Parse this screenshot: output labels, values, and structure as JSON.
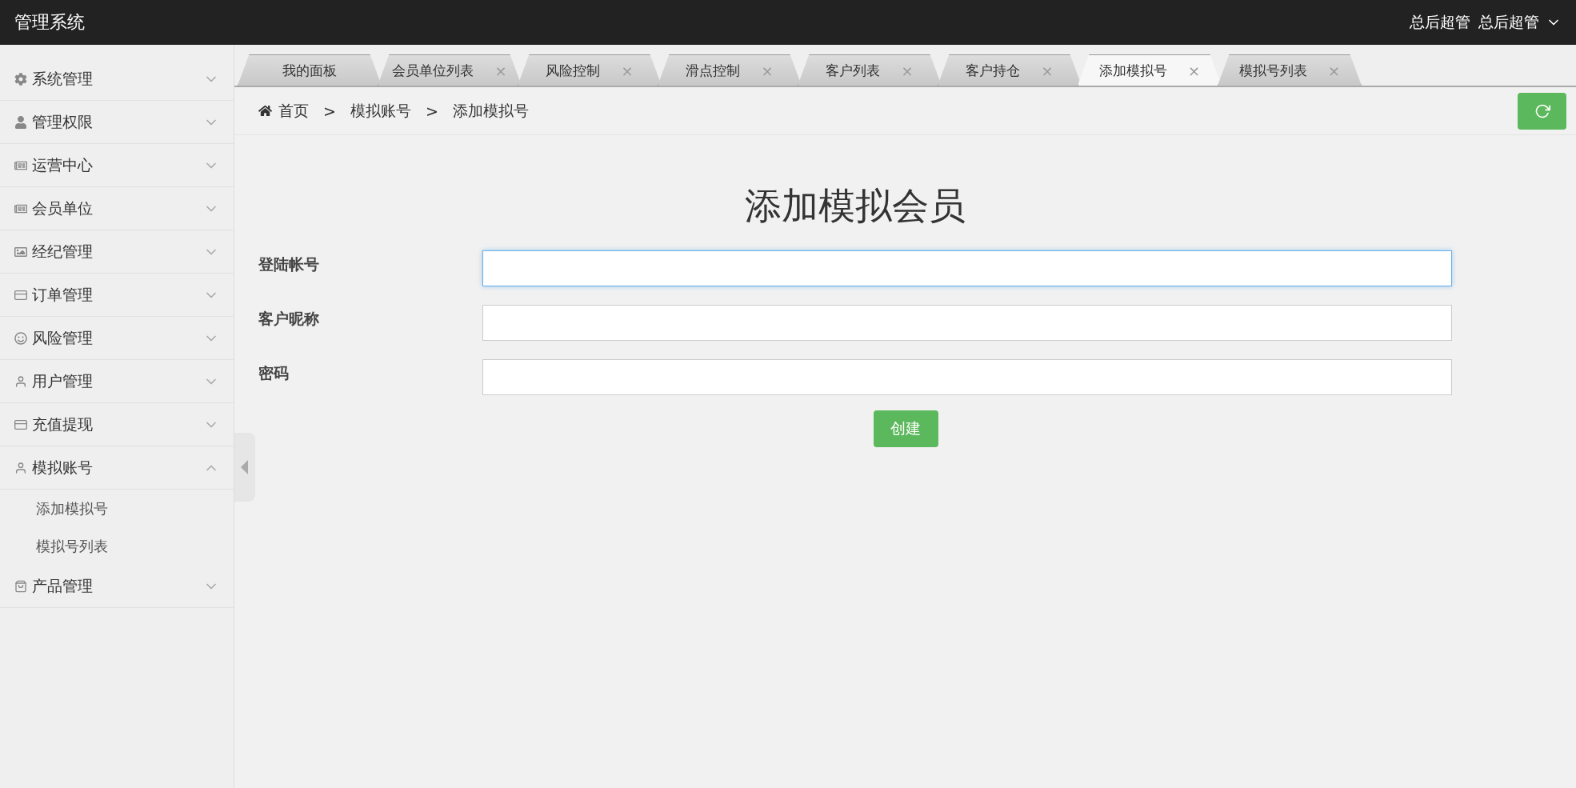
{
  "header": {
    "title": "管理系统",
    "user_role": "总后超管",
    "user_name": "总后超管"
  },
  "sidebar": {
    "items": [
      {
        "label": "系统管理",
        "expanded": false
      },
      {
        "label": "管理权限",
        "expanded": false
      },
      {
        "label": "运营中心",
        "expanded": false
      },
      {
        "label": "会员单位",
        "expanded": false
      },
      {
        "label": "经纪管理",
        "expanded": false
      },
      {
        "label": "订单管理",
        "expanded": false
      },
      {
        "label": "风险管理",
        "expanded": false
      },
      {
        "label": "用户管理",
        "expanded": false
      },
      {
        "label": "充值提现",
        "expanded": false
      },
      {
        "label": "模拟账号",
        "expanded": true,
        "children": [
          {
            "label": "添加模拟号",
            "selected": false
          },
          {
            "label": "模拟号列表",
            "selected": false
          }
        ]
      },
      {
        "label": "产品管理",
        "expanded": false
      }
    ]
  },
  "tabs": [
    {
      "label": "我的面板",
      "selected": false,
      "closable": false
    },
    {
      "label": "会员单位列表",
      "selected": false,
      "closable": true
    },
    {
      "label": "风险控制",
      "selected": false,
      "closable": true
    },
    {
      "label": "滑点控制",
      "selected": false,
      "closable": true
    },
    {
      "label": "客户列表",
      "selected": false,
      "closable": true
    },
    {
      "label": "客户持仓",
      "selected": false,
      "closable": true
    },
    {
      "label": "添加模拟号",
      "selected": true,
      "closable": true
    },
    {
      "label": "模拟号列表",
      "selected": false,
      "closable": true
    }
  ],
  "close_glyph": "×",
  "breadcrumb": {
    "items": [
      "首页",
      "模拟账号",
      "添加模拟号"
    ],
    "separator": ">"
  },
  "form": {
    "title": "添加模拟会员",
    "fields": [
      {
        "label": "登陆帐号",
        "focused": true
      },
      {
        "label": "客户昵称",
        "focused": false
      },
      {
        "label": "密码",
        "focused": false
      }
    ],
    "submit": "创建"
  }
}
